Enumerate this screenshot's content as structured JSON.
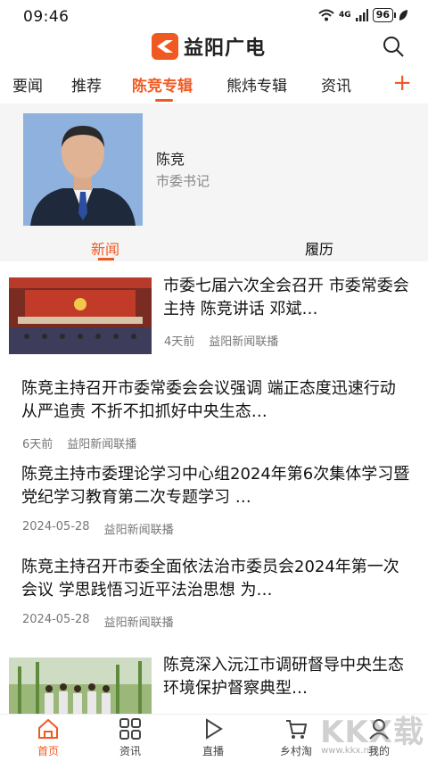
{
  "status": {
    "time": "09:46",
    "signal": "4G",
    "battery": "96"
  },
  "app": {
    "name": "益阳广电",
    "brand_color": "#f05a22"
  },
  "tabs": [
    {
      "label": "要闻"
    },
    {
      "label": "推荐"
    },
    {
      "label": "陈竞专辑"
    },
    {
      "label": "熊炜专辑"
    },
    {
      "label": "资讯"
    }
  ],
  "profile": {
    "name": "陈竞",
    "title": "市委书记",
    "sub_tabs": [
      {
        "label": "新闻"
      },
      {
        "label": "履历"
      }
    ]
  },
  "news": [
    {
      "title": "市委七届六次全会召开 市委常委会主持 陈竞讲话 邓斌…",
      "time": "4天前",
      "source": "益阳新闻联播",
      "has_thumb": true
    },
    {
      "title": "陈竞主持召开市委常委会会议强调 端正态度迅速行动 从严追责 不折不扣抓好中央生态…",
      "time": "6天前",
      "source": "益阳新闻联播",
      "has_thumb": false
    },
    {
      "title": "陈竞主持市委理论学习中心组2024年第6次集体学习暨党纪学习教育第二次专题学习 …",
      "time": "2024-05-28",
      "source": "益阳新闻联播",
      "has_thumb": false
    },
    {
      "title": "陈竞主持召开市委全面依法治市委员会2024年第一次会议 学思践悟习近平法治思想 为…",
      "time": "2024-05-28",
      "source": "益阳新闻联播",
      "has_thumb": false
    },
    {
      "title": "陈竞深入沅江市调研督导中央生态环境保护督察典型…",
      "has_thumb": true
    }
  ],
  "bottom_nav": [
    {
      "label": "首页",
      "icon": "home-icon"
    },
    {
      "label": "资讯",
      "icon": "grid-icon"
    },
    {
      "label": "直播",
      "icon": "play-icon"
    },
    {
      "label": "乡村淘",
      "icon": "cart-icon"
    },
    {
      "label": "我的",
      "icon": "user-icon"
    }
  ],
  "watermark": {
    "text": "KKX载",
    "url": "www.kkx.net"
  }
}
